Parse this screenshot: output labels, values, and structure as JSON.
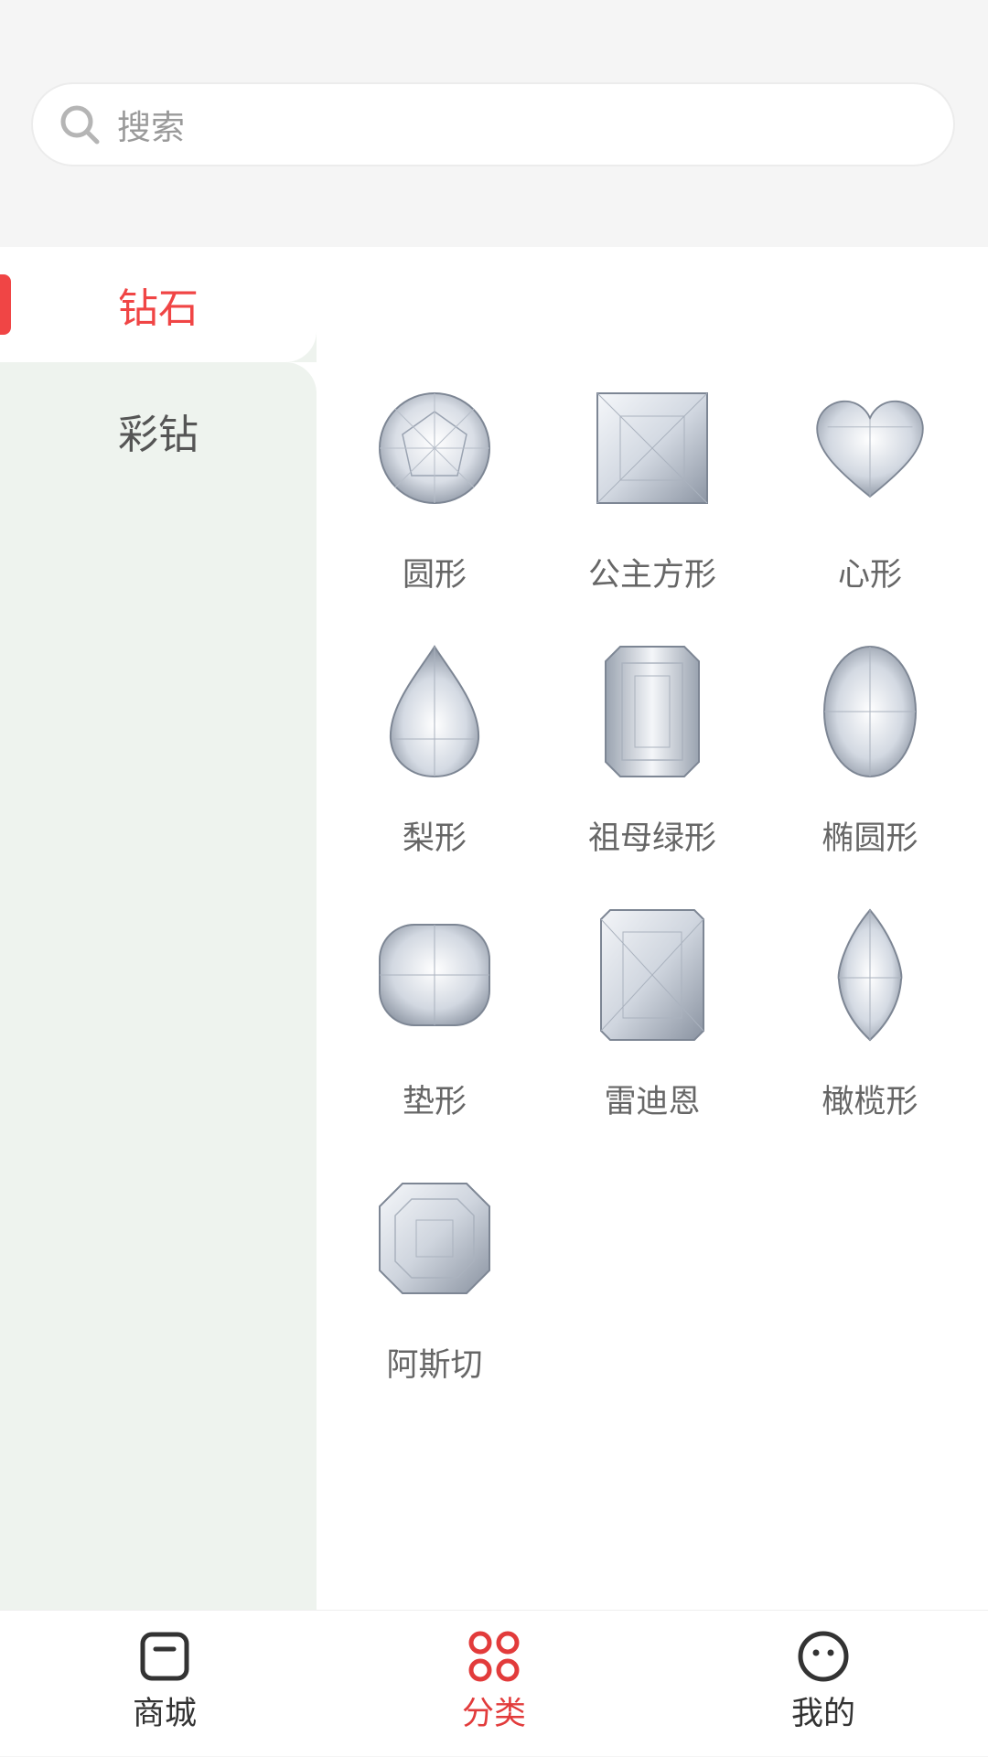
{
  "search": {
    "placeholder": "搜索"
  },
  "sidebar": {
    "items": [
      {
        "label": "钻石",
        "active": true
      },
      {
        "label": "彩钻",
        "active": false
      }
    ]
  },
  "grid": {
    "items": [
      {
        "label": "圆形",
        "icon": "round-diamond-icon"
      },
      {
        "label": "公主方形",
        "icon": "princess-diamond-icon"
      },
      {
        "label": "心形",
        "icon": "heart-diamond-icon"
      },
      {
        "label": "梨形",
        "icon": "pear-diamond-icon"
      },
      {
        "label": "祖母绿形",
        "icon": "emerald-diamond-icon"
      },
      {
        "label": "椭圆形",
        "icon": "oval-diamond-icon"
      },
      {
        "label": "垫形",
        "icon": "cushion-diamond-icon"
      },
      {
        "label": "雷迪恩",
        "icon": "radiant-diamond-icon"
      },
      {
        "label": "橄榄形",
        "icon": "marquise-diamond-icon"
      },
      {
        "label": "阿斯切",
        "icon": "asscher-diamond-icon"
      }
    ]
  },
  "tabbar": {
    "tabs": [
      {
        "label": "商城",
        "icon": "store-icon",
        "active": false
      },
      {
        "label": "分类",
        "icon": "category-icon",
        "active": true
      },
      {
        "label": "我的",
        "icon": "profile-icon",
        "active": false
      }
    ]
  },
  "colors": {
    "accent": "#f04545",
    "sidebar_bg": "#eef3ee",
    "header_bg": "#f5f5f5"
  }
}
